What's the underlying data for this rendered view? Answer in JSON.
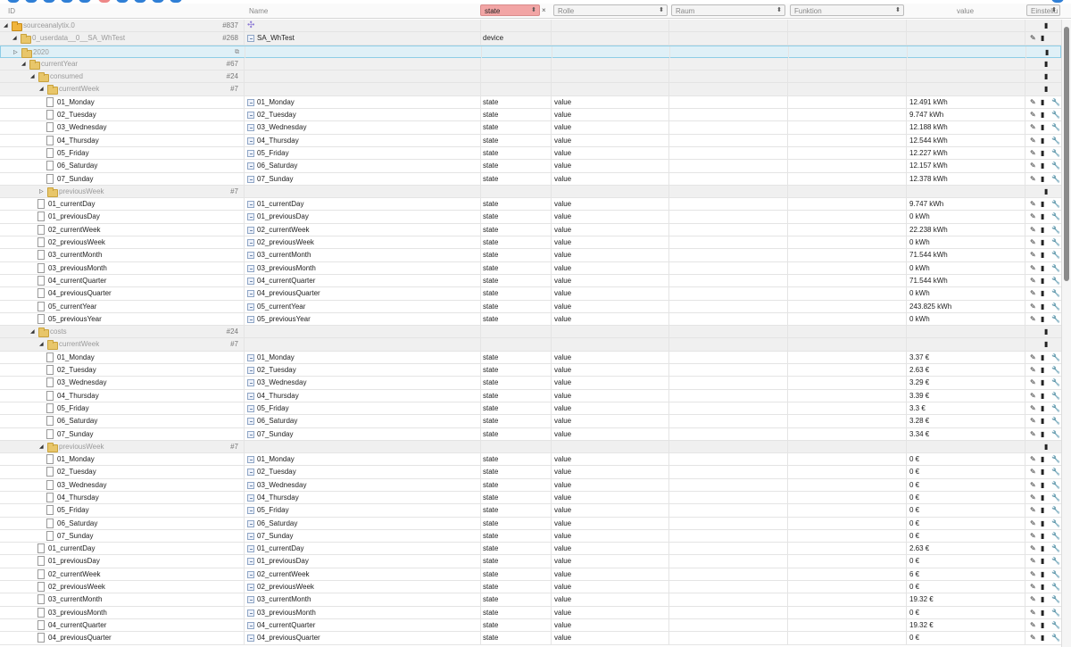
{
  "header": {
    "id_label": "ID",
    "name_label": "Name",
    "type_filter": "state",
    "type_clear": "×",
    "role_filter": "Rolle",
    "room_filter": "Raum",
    "function_filter": "Funktion",
    "value_label": "value",
    "settings_label": "Einstellu"
  },
  "icons": {
    "toggle_open": "◢",
    "toggle_closed": "▷",
    "select_arrow": "⬍",
    "edit": "✎",
    "delete": "▮",
    "settings": "🔧",
    "plugin": "✣",
    "copy": "⧉"
  },
  "colors": {
    "accent": "#2f7fd6",
    "filter_active": "#f2a5a5",
    "selection": "#dff0f7",
    "folder": "#e8c66a"
  },
  "rows": [
    {
      "id": "sourceanalytix.0",
      "level": 0,
      "kind": "adapter",
      "open": true,
      "count": "#837",
      "name": "",
      "type": "",
      "role": "",
      "value": "",
      "actions": "plugin-only"
    },
    {
      "id": "0_userdata__0__SA_WhTest",
      "level": 1,
      "kind": "folder",
      "open": true,
      "count": "#268",
      "name": "SA_WhTest",
      "type": "device",
      "role": "",
      "value": "",
      "actions": "edit-delete",
      "name_icon": true
    },
    {
      "id": "2020",
      "level": 1,
      "kind": "folder",
      "open": false,
      "count": "⧉",
      "name": "",
      "type": "",
      "role": "",
      "value": "",
      "actions": "delete",
      "selected": true
    },
    {
      "id": "currentYear",
      "level": 2,
      "kind": "folder",
      "open": true,
      "count": "#67",
      "name": "",
      "type": "",
      "role": "",
      "value": "",
      "actions": "delete"
    },
    {
      "id": "consumed",
      "level": 3,
      "kind": "folder",
      "open": true,
      "count": "#24",
      "name": "",
      "type": "",
      "role": "",
      "value": "",
      "actions": "delete"
    },
    {
      "id": "currentWeek",
      "level": 4,
      "kind": "folder",
      "open": true,
      "count": "#7",
      "name": "",
      "type": "",
      "role": "",
      "value": "",
      "actions": "delete"
    },
    {
      "id": "01_Monday",
      "level": 5,
      "kind": "state",
      "name": "01_Monday",
      "type": "state",
      "role": "value",
      "value": "12.491 kWh",
      "actions": "all"
    },
    {
      "id": "02_Tuesday",
      "level": 5,
      "kind": "state",
      "name": "02_Tuesday",
      "type": "state",
      "role": "value",
      "value": "9.747 kWh",
      "actions": "all"
    },
    {
      "id": "03_Wednesday",
      "level": 5,
      "kind": "state",
      "name": "03_Wednesday",
      "type": "state",
      "role": "value",
      "value": "12.188 kWh",
      "actions": "all"
    },
    {
      "id": "04_Thursday",
      "level": 5,
      "kind": "state",
      "name": "04_Thursday",
      "type": "state",
      "role": "value",
      "value": "12.544 kWh",
      "actions": "all"
    },
    {
      "id": "05_Friday",
      "level": 5,
      "kind": "state",
      "name": "05_Friday",
      "type": "state",
      "role": "value",
      "value": "12.227 kWh",
      "actions": "all"
    },
    {
      "id": "06_Saturday",
      "level": 5,
      "kind": "state",
      "name": "06_Saturday",
      "type": "state",
      "role": "value",
      "value": "12.157 kWh",
      "actions": "all"
    },
    {
      "id": "07_Sunday",
      "level": 5,
      "kind": "state",
      "name": "07_Sunday",
      "type": "state",
      "role": "value",
      "value": "12.378 kWh",
      "actions": "all"
    },
    {
      "id": "previousWeek",
      "level": 4,
      "kind": "folder",
      "open": false,
      "count": "#7",
      "name": "",
      "type": "",
      "role": "",
      "value": "",
      "actions": "delete"
    },
    {
      "id": "01_currentDay",
      "level": 4,
      "kind": "state",
      "name": "01_currentDay",
      "type": "state",
      "role": "value",
      "value": "9.747 kWh",
      "actions": "all"
    },
    {
      "id": "01_previousDay",
      "level": 4,
      "kind": "state",
      "name": "01_previousDay",
      "type": "state",
      "role": "value",
      "value": "0 kWh",
      "actions": "all"
    },
    {
      "id": "02_currentWeek",
      "level": 4,
      "kind": "state",
      "name": "02_currentWeek",
      "type": "state",
      "role": "value",
      "value": "22.238 kWh",
      "actions": "all"
    },
    {
      "id": "02_previousWeek",
      "level": 4,
      "kind": "state",
      "name": "02_previousWeek",
      "type": "state",
      "role": "value",
      "value": "0 kWh",
      "actions": "all"
    },
    {
      "id": "03_currentMonth",
      "level": 4,
      "kind": "state",
      "name": "03_currentMonth",
      "type": "state",
      "role": "value",
      "value": "71.544 kWh",
      "actions": "all"
    },
    {
      "id": "03_previousMonth",
      "level": 4,
      "kind": "state",
      "name": "03_previousMonth",
      "type": "state",
      "role": "value",
      "value": "0 kWh",
      "actions": "all"
    },
    {
      "id": "04_currentQuarter",
      "level": 4,
      "kind": "state",
      "name": "04_currentQuarter",
      "type": "state",
      "role": "value",
      "value": "71.544 kWh",
      "actions": "all"
    },
    {
      "id": "04_previousQuarter",
      "level": 4,
      "kind": "state",
      "name": "04_previousQuarter",
      "type": "state",
      "role": "value",
      "value": "0 kWh",
      "actions": "all"
    },
    {
      "id": "05_currentYear",
      "level": 4,
      "kind": "state",
      "name": "05_currentYear",
      "type": "state",
      "role": "value",
      "value": "243.825 kWh",
      "actions": "all"
    },
    {
      "id": "05_previousYear",
      "level": 4,
      "kind": "state",
      "name": "05_previousYear",
      "type": "state",
      "role": "value",
      "value": "0 kWh",
      "actions": "all"
    },
    {
      "id": "costs",
      "level": 3,
      "kind": "folder",
      "open": true,
      "count": "#24",
      "name": "",
      "type": "",
      "role": "",
      "value": "",
      "actions": "delete"
    },
    {
      "id": "currentWeek",
      "level": 4,
      "kind": "folder",
      "open": true,
      "count": "#7",
      "name": "",
      "type": "",
      "role": "",
      "value": "",
      "actions": "delete"
    },
    {
      "id": "01_Monday",
      "level": 5,
      "kind": "state",
      "name": "01_Monday",
      "type": "state",
      "role": "value",
      "value": "3.37 €",
      "actions": "all"
    },
    {
      "id": "02_Tuesday",
      "level": 5,
      "kind": "state",
      "name": "02_Tuesday",
      "type": "state",
      "role": "value",
      "value": "2.63 €",
      "actions": "all"
    },
    {
      "id": "03_Wednesday",
      "level": 5,
      "kind": "state",
      "name": "03_Wednesday",
      "type": "state",
      "role": "value",
      "value": "3.29 €",
      "actions": "all"
    },
    {
      "id": "04_Thursday",
      "level": 5,
      "kind": "state",
      "name": "04_Thursday",
      "type": "state",
      "role": "value",
      "value": "3.39 €",
      "actions": "all"
    },
    {
      "id": "05_Friday",
      "level": 5,
      "kind": "state",
      "name": "05_Friday",
      "type": "state",
      "role": "value",
      "value": "3.3 €",
      "actions": "all"
    },
    {
      "id": "06_Saturday",
      "level": 5,
      "kind": "state",
      "name": "06_Saturday",
      "type": "state",
      "role": "value",
      "value": "3.28 €",
      "actions": "all"
    },
    {
      "id": "07_Sunday",
      "level": 5,
      "kind": "state",
      "name": "07_Sunday",
      "type": "state",
      "role": "value",
      "value": "3.34 €",
      "actions": "all"
    },
    {
      "id": "previousWeek",
      "level": 4,
      "kind": "folder",
      "open": true,
      "count": "#7",
      "name": "",
      "type": "",
      "role": "",
      "value": "",
      "actions": "delete"
    },
    {
      "id": "01_Monday",
      "level": 5,
      "kind": "state",
      "name": "01_Monday",
      "type": "state",
      "role": "value",
      "value": "0 €",
      "actions": "all"
    },
    {
      "id": "02_Tuesday",
      "level": 5,
      "kind": "state",
      "name": "02_Tuesday",
      "type": "state",
      "role": "value",
      "value": "0 €",
      "actions": "all"
    },
    {
      "id": "03_Wednesday",
      "level": 5,
      "kind": "state",
      "name": "03_Wednesday",
      "type": "state",
      "role": "value",
      "value": "0 €",
      "actions": "all"
    },
    {
      "id": "04_Thursday",
      "level": 5,
      "kind": "state",
      "name": "04_Thursday",
      "type": "state",
      "role": "value",
      "value": "0 €",
      "actions": "all"
    },
    {
      "id": "05_Friday",
      "level": 5,
      "kind": "state",
      "name": "05_Friday",
      "type": "state",
      "role": "value",
      "value": "0 €",
      "actions": "all"
    },
    {
      "id": "06_Saturday",
      "level": 5,
      "kind": "state",
      "name": "06_Saturday",
      "type": "state",
      "role": "value",
      "value": "0 €",
      "actions": "all"
    },
    {
      "id": "07_Sunday",
      "level": 5,
      "kind": "state",
      "name": "07_Sunday",
      "type": "state",
      "role": "value",
      "value": "0 €",
      "actions": "all"
    },
    {
      "id": "01_currentDay",
      "level": 4,
      "kind": "state",
      "name": "01_currentDay",
      "type": "state",
      "role": "value",
      "value": "2.63 €",
      "actions": "all"
    },
    {
      "id": "01_previousDay",
      "level": 4,
      "kind": "state",
      "name": "01_previousDay",
      "type": "state",
      "role": "value",
      "value": "0 €",
      "actions": "all"
    },
    {
      "id": "02_currentWeek",
      "level": 4,
      "kind": "state",
      "name": "02_currentWeek",
      "type": "state",
      "role": "value",
      "value": "6 €",
      "actions": "all"
    },
    {
      "id": "02_previousWeek",
      "level": 4,
      "kind": "state",
      "name": "02_previousWeek",
      "type": "state",
      "role": "value",
      "value": "0 €",
      "actions": "all"
    },
    {
      "id": "03_currentMonth",
      "level": 4,
      "kind": "state",
      "name": "03_currentMonth",
      "type": "state",
      "role": "value",
      "value": "19.32 €",
      "actions": "all"
    },
    {
      "id": "03_previousMonth",
      "level": 4,
      "kind": "state",
      "name": "03_previousMonth",
      "type": "state",
      "role": "value",
      "value": "0 €",
      "actions": "all"
    },
    {
      "id": "04_currentQuarter",
      "level": 4,
      "kind": "state",
      "name": "04_currentQuarter",
      "type": "state",
      "role": "value",
      "value": "19.32 €",
      "actions": "all"
    },
    {
      "id": "04_previousQuarter",
      "level": 4,
      "kind": "state",
      "name": "04_previousQuarter",
      "type": "state",
      "role": "value",
      "value": "0 €",
      "actions": "all"
    }
  ]
}
